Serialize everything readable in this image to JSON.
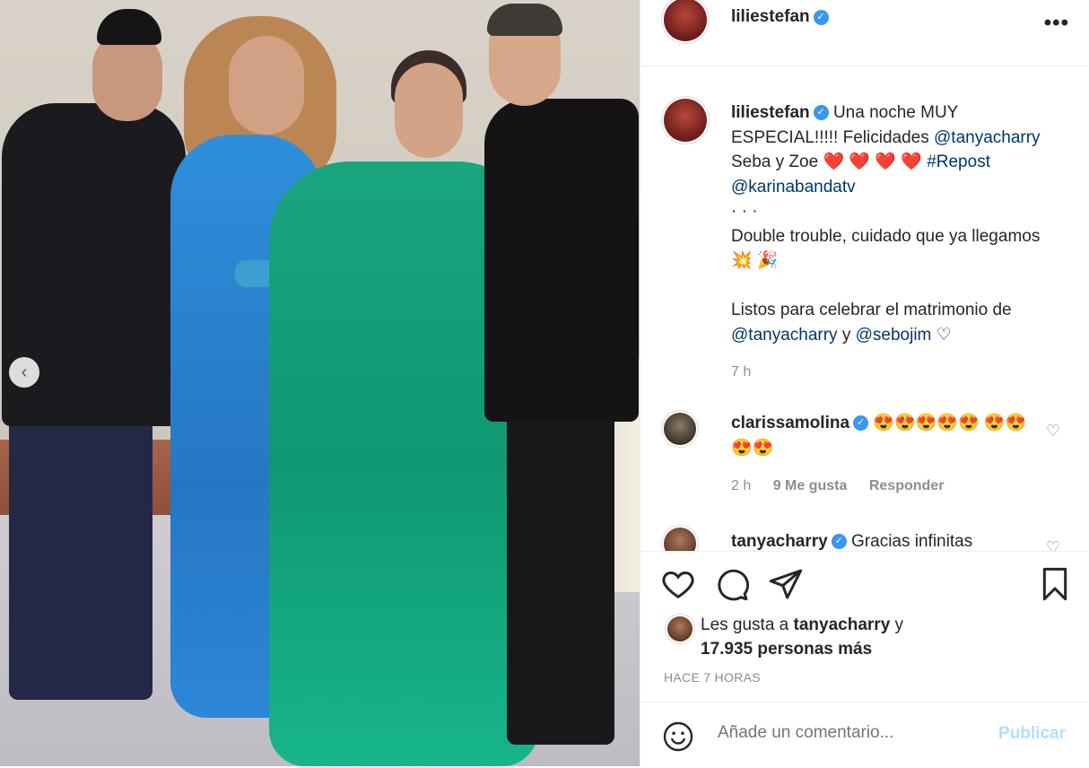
{
  "header": {
    "username": "liliestefan",
    "more_label": "•••"
  },
  "caption": {
    "username": "liliestefan",
    "text_1": "Una noche MUY ESPECIAL!!!!! Felicidades",
    "mention_1": "@tanyacharry",
    "text_2": "Seba y Zoe",
    "hearts": "❤️ ❤️ ❤️ ❤️",
    "hashtag": "#Repost",
    "mention_2": "@karinabandatv",
    "dots": "·  ·  ·",
    "line_3": "Double trouble, cuidado que ya llegamos",
    "emoji_1": "💥 🎉",
    "line_4": "Listos para celebrar el matrimonio de",
    "mention_3": "@tanyacharry",
    "text_y": "y",
    "mention_4": "@sebojim",
    "heart_outline": "♡",
    "time": "7 h"
  },
  "comments": [
    {
      "username": "clarissamolina",
      "text": "😍😍😍😍😍 😍😍😍😍",
      "time": "2 h",
      "likes": "9 Me gusta",
      "reply": "Responder"
    },
    {
      "username": "tanyacharry",
      "text": "Gracias infinitas"
    }
  ],
  "likes": {
    "prefix": "Les gusta a",
    "user": "tanyacharry",
    "suffix": "y",
    "count": "17.935 personas más"
  },
  "timestamp": "HACE 7 HORAS",
  "comment_input": {
    "placeholder": "Añade un comentario..."
  },
  "publish_label": "Publicar",
  "colors": {
    "mention": "#00376b",
    "verified": "#3897f0",
    "publish": "#b2dffc"
  },
  "icons": [
    "heart-icon",
    "comment-icon",
    "share-icon",
    "bookmark-icon",
    "emoji-icon",
    "chevron-left-icon",
    "verified-icon"
  ]
}
